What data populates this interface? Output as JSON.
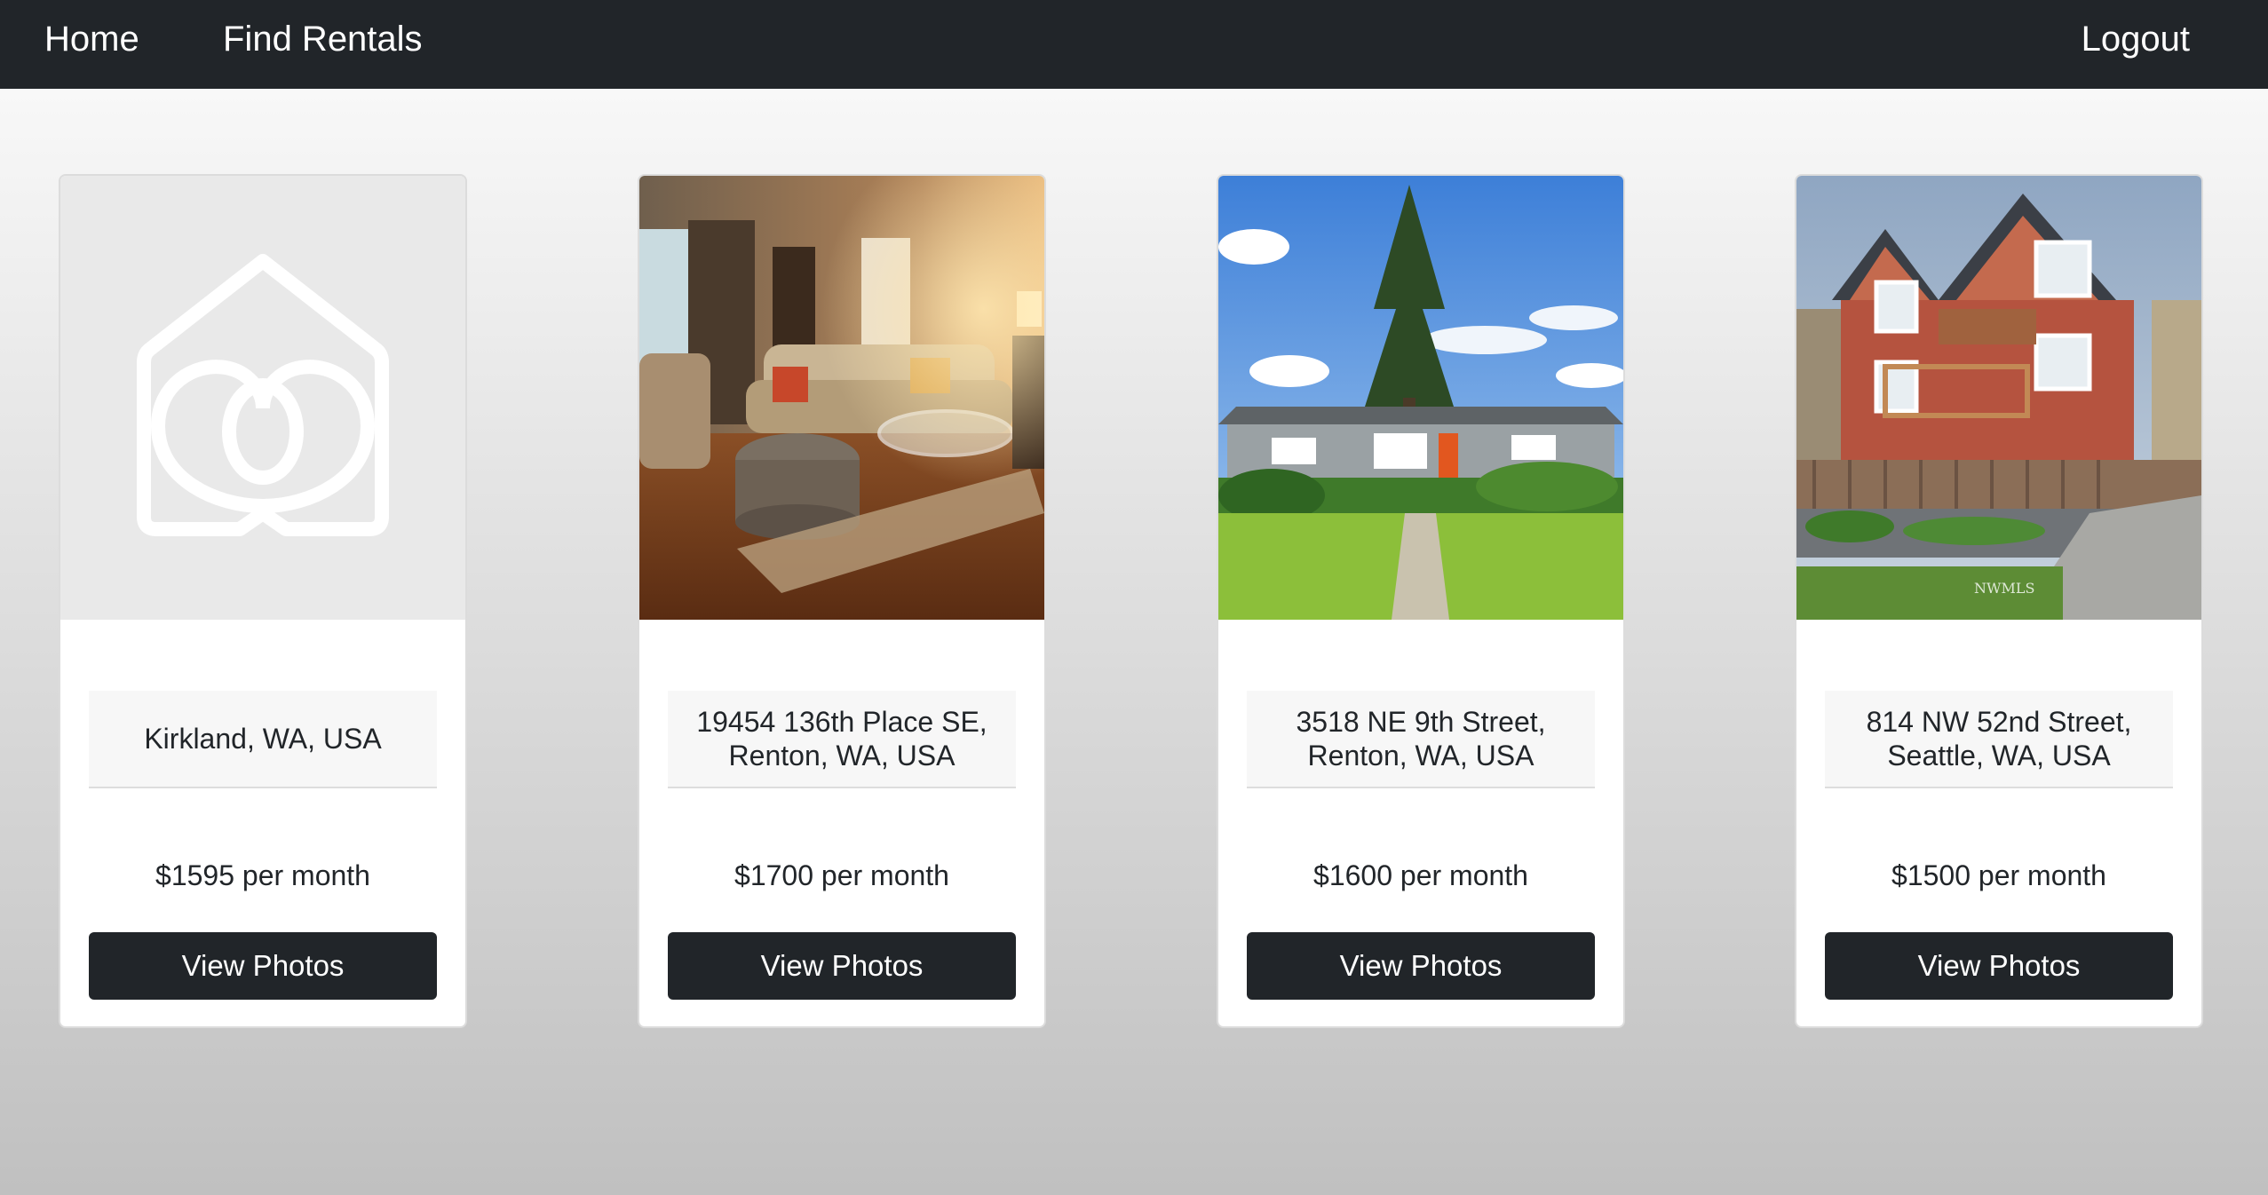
{
  "nav": {
    "home": "Home",
    "find_rentals": "Find Rentals",
    "logout": "Logout"
  },
  "listings": [
    {
      "address": "Kirkland, WA, USA",
      "price": "$1595 per month",
      "button": "View Photos",
      "image": "placeholder-house-heart-icon"
    },
    {
      "address": "19454 136th Place SE, Renton, WA, USA",
      "price": "$1700 per month",
      "button": "View Photos",
      "image": "living-room-photo"
    },
    {
      "address": "3518 NE 9th Street, Renton, WA, USA",
      "price": "$1600 per month",
      "button": "View Photos",
      "image": "gray-house-with-tree-photo"
    },
    {
      "address": "814 NW 52nd Street, Seattle, WA, USA",
      "price": "$1500 per month",
      "button": "View Photos",
      "image": "red-townhouse-photo",
      "watermark": "NWMLS"
    }
  ],
  "colors": {
    "navbar": "#212529",
    "button": "#212529",
    "card_bg": "#ffffff",
    "address_bg": "#f7f7f7"
  }
}
